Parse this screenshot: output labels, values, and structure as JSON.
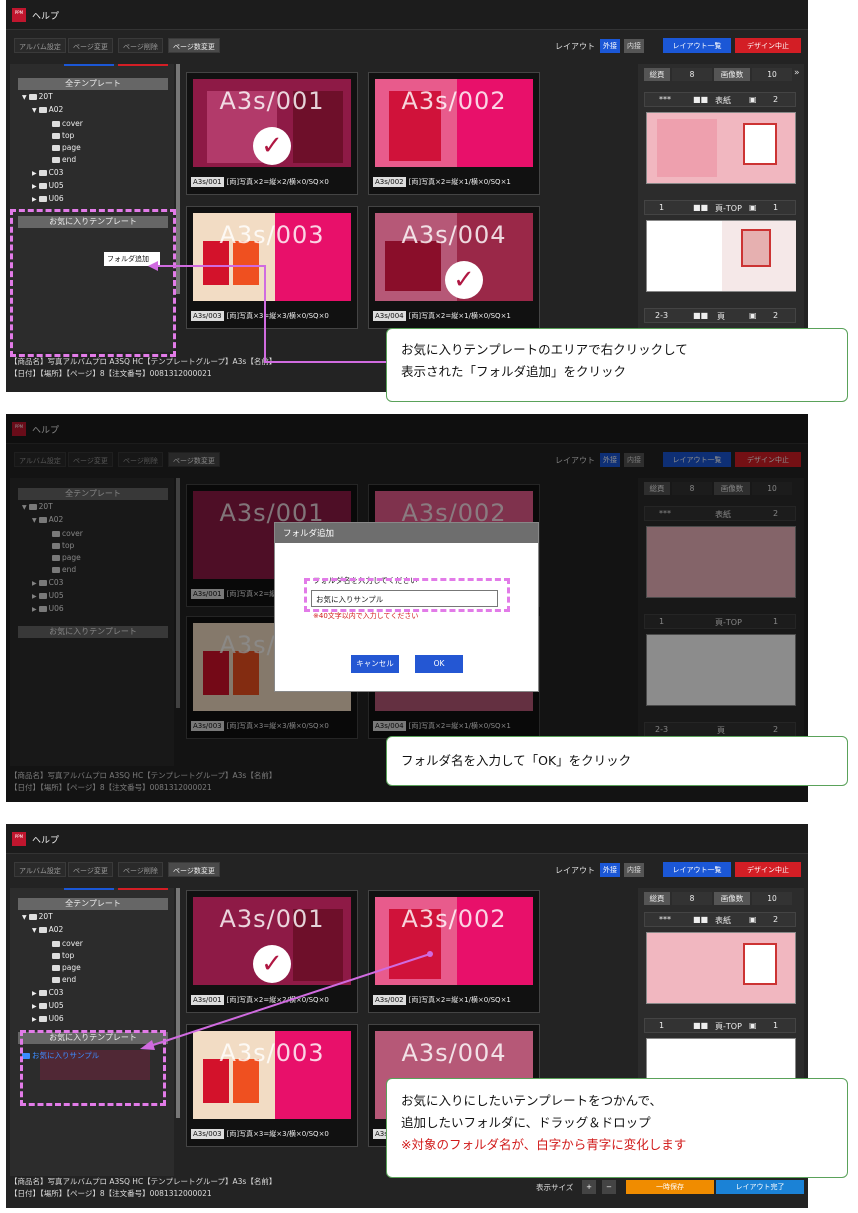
{
  "app": {
    "title": "ヘルプ",
    "logo": "PPM"
  },
  "toolbar": {
    "album_settings": "アルバム設定",
    "page_edit": "ページ変更",
    "page_delete": "ページ削除",
    "page_count": "ページ数変更",
    "layout_label": "レイアウト",
    "outer": "外接",
    "inner": "内接",
    "layout_list": "レイアウト一覧",
    "design_stop": "デザイン中止"
  },
  "left": {
    "all_templates": "全テンプレート",
    "favorite_templates": "お気に入りテンプレート",
    "tree": [
      "20T",
      "A02",
      "cover",
      "top",
      "page",
      "end",
      "C03",
      "U05",
      "U06"
    ],
    "context_menu_item": "フォルダ追加",
    "favorite_folder": "お気に入りサンプル"
  },
  "templates": [
    {
      "id": "A3s/001",
      "spec": "[両]写真×2=縦×2/横×0/SQ×0",
      "selected": true
    },
    {
      "id": "A3s/002",
      "spec": "[両]写真×2=縦×1/横×0/SQ×1",
      "selected": false
    },
    {
      "id": "A3s/003",
      "spec": "[両]写真×3=縦×3/横×0/SQ×0",
      "selected": false
    },
    {
      "id": "A3s/004",
      "spec": "[両]写真×2=縦×1/横×0/SQ×1",
      "selected": true
    }
  ],
  "right": {
    "total_label": "総頁",
    "total": "8",
    "images_label": "画像数",
    "images": "10",
    "more": "»",
    "rows": [
      {
        "page": "***",
        "label": "表紙",
        "count": "2"
      },
      {
        "page": "1",
        "label": "頁-TOP",
        "count": "1"
      },
      {
        "page": "2-3",
        "label": "頁",
        "count": "2"
      }
    ]
  },
  "footer": {
    "line1": "【商品名】写真アルバムプロ A3SQ HC【テンプレートグループ】A3s【名前】",
    "line2": "【日付】【場所】【ページ】8【注文番号】0081312000021"
  },
  "dialog": {
    "title": "フォルダ追加",
    "prompt": "フォルダ名を入力してください",
    "input_value": "お気に入りサンプル",
    "note": "※40文字以内で入力してください",
    "cancel": "キャンセル",
    "ok": "OK"
  },
  "bottom_bar": {
    "display_size": "表示サイズ",
    "plus": "+",
    "minus": "−",
    "temp_save": "一時保存",
    "layout_done": "レイアウト完了"
  },
  "callouts": {
    "step1_line1": "お気に入りテンプレートのエリアで右クリックして",
    "step1_line2": "表示された「フォルダ追加」をクリック",
    "step2": "フォルダ名を入力して「OK」をクリック",
    "step3_line1": "お気に入りにしたいテンプレートをつかんで、",
    "step3_line2": "追加したいフォルダに、ドラッグ＆ドロップ",
    "step3_line3": "※対象のフォルダ名が、白字から青字に変化します"
  },
  "colors": {
    "accent_blue": "#1b57d6",
    "accent_red": "#d31e25",
    "dash": "#e27be8",
    "arrow": "#d06be0",
    "callout_border": "#5aa25a",
    "note_red": "#d11a1a"
  }
}
